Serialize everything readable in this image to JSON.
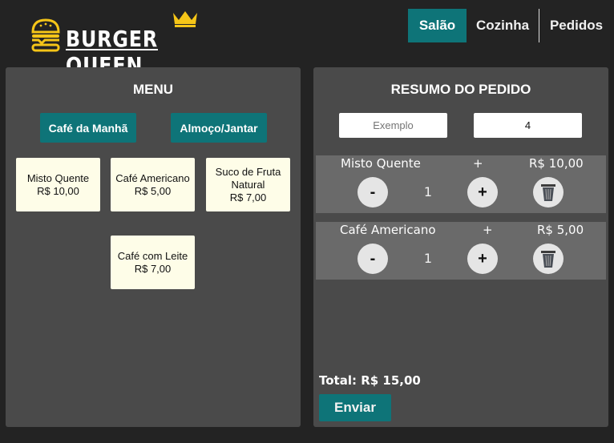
{
  "brand": {
    "name": "BURGER QUEEN"
  },
  "nav": {
    "items": [
      {
        "label": "Salão"
      },
      {
        "label": "Cozinha"
      },
      {
        "label": "Pedidos"
      }
    ]
  },
  "menu": {
    "title": "MENU",
    "categories": [
      {
        "label": "Café da Manhã"
      },
      {
        "label": "Almoço/Jantar"
      }
    ],
    "items": [
      {
        "name": "Misto Quente",
        "price": "R$ 10,00"
      },
      {
        "name": "Café Americano",
        "price": "R$ 5,00"
      },
      {
        "name": "Suco de Fruta Natural",
        "price": "R$ 7,00"
      },
      {
        "name": "Café com Leite",
        "price": "R$ 7,00"
      }
    ]
  },
  "summary": {
    "title": "RESUMO DO PEDIDO",
    "client_name": {
      "placeholder": "Exemplo",
      "value": ""
    },
    "table_number": {
      "value": "4"
    },
    "items": [
      {
        "name": "Misto Quente",
        "plus": "+",
        "price": "R$ 10,00",
        "minus_label": "-",
        "quantity": "1",
        "plus_label": "+"
      },
      {
        "name": "Café Americano",
        "plus": "+",
        "price": "R$ 5,00",
        "minus_label": "-",
        "quantity": "1",
        "plus_label": "+"
      }
    ],
    "total": "Total: R$ 15,00",
    "send_label": "Enviar"
  },
  "colors": {
    "accent": "#0e7478",
    "brand_yellow": "#f5c518",
    "panel": "#4a4a4a",
    "card": "#fefde8"
  }
}
